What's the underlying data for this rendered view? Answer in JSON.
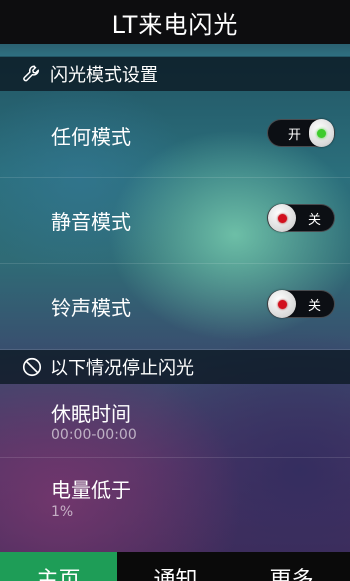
{
  "title": "LT来电闪光",
  "section_flash_mode": {
    "icon": "wrench-icon",
    "label": "闪光模式设置",
    "items": [
      {
        "label": "任何模式",
        "toggle_text": "开",
        "on": true
      },
      {
        "label": "静音模式",
        "toggle_text": "关",
        "on": false
      },
      {
        "label": "铃声模式",
        "toggle_text": "关",
        "on": false
      }
    ]
  },
  "section_stop_flash": {
    "icon": "prohibited-icon",
    "label": "以下情况停止闪光",
    "items": [
      {
        "label": "休眠时间",
        "value": "00:00-00:00"
      },
      {
        "label": "电量低于",
        "value": "1%"
      }
    ]
  },
  "tabs": [
    {
      "label": "主页",
      "active": true
    },
    {
      "label": "通知",
      "active": false
    },
    {
      "label": "更多",
      "active": false
    }
  ],
  "colors": {
    "accent": "#1e9d57",
    "toggle_on_dot": "#3ecb2c",
    "toggle_off_dot": "#d2101e"
  }
}
